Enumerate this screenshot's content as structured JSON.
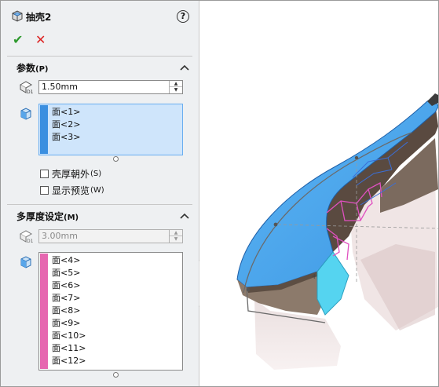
{
  "header": {
    "title": "抽壳2",
    "help_label": "?"
  },
  "actions": {
    "ok_symbol": "✔",
    "cancel_symbol": "✕"
  },
  "params": {
    "title": "参数",
    "title_key": "(P)",
    "thickness_value": "1.50mm",
    "faces": [
      "面<1>",
      "面<2>",
      "面<3>"
    ],
    "options": [
      {
        "label": "壳厚朝外",
        "key": "(S)"
      },
      {
        "label": "显示预览",
        "key": "(W)"
      }
    ]
  },
  "multi": {
    "title": "多厚度设定",
    "title_key": "(M)",
    "thickness_value": "3.00mm",
    "faces": [
      "面<4>",
      "面<5>",
      "面<6>",
      "面<7>",
      "面<8>",
      "面<9>",
      "面<10>",
      "面<11>",
      "面<12>"
    ]
  },
  "colors": {
    "params_face_stripe": "#3b8fe0",
    "multi_face_stripe": "#e667b0",
    "model_face_blue": "#4aa8f0",
    "model_highlight_pink": "#e050c0"
  },
  "icons": {
    "feature": "shell-feature-icon",
    "thickness": "thickness-dimension-icon",
    "faces": "face-selection-cube-icon"
  }
}
